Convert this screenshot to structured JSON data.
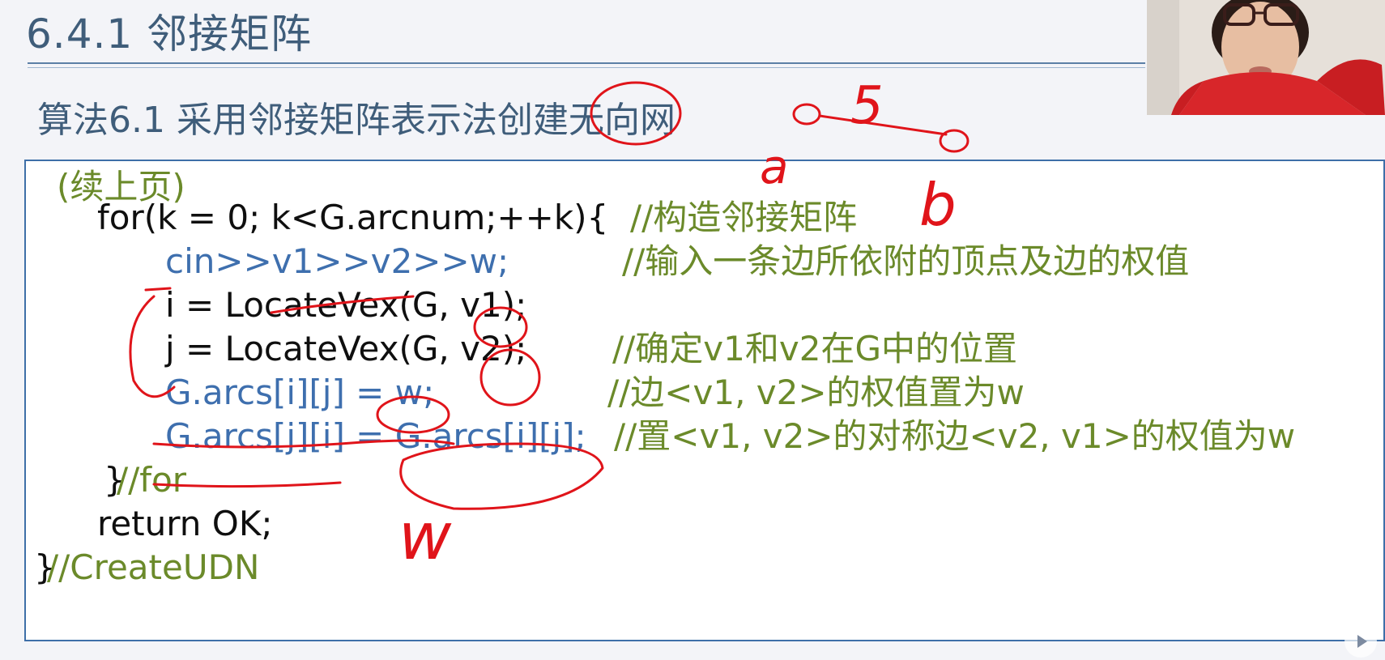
{
  "slide": {
    "section_title": "6.4.1 邻接矩阵",
    "algorithm_title": "算法6.1 采用邻接矩阵表示法创建无向网"
  },
  "code": {
    "continued": "(续上页)",
    "for_head": "for(k = 0; k<G.arcnum;++k){",
    "for_comment": "//构造邻接矩阵",
    "cin_stmt": "cin>>v1>>v2>>w;",
    "cin_comment": "//输入一条边所依附的顶点及边的权值",
    "locate_i": "i = LocateVex(G, v1);",
    "locate_j": "j = LocateVex(G, v2);",
    "locate_comment": "//确定v1和v2在G中的位置",
    "arcs_ij": "G.arcs[i][j] = w;",
    "arcs_ij_comment": "//边<v1, v2>的权值置为w",
    "arcs_ji": "G.arcs[j][i] = G.arcs[i][j];",
    "arcs_ji_comment": "//置<v1, v2>的对称边<v2, v1>的权值为w",
    "close_for_brace": "}",
    "close_for_comment": "//for",
    "return_stmt": "return OK;",
    "close_func_brace": "}",
    "close_func_comment": "//CreateUDN"
  },
  "annotations": {
    "edge_weight": "5",
    "vertex_a": "a",
    "vertex_b": "b",
    "handwritten_w": "w"
  },
  "colors": {
    "title": "#3f5d7a",
    "code_black": "#0f0f0f",
    "code_blue": "#3e6fae",
    "comment_green": "#6b8a2a",
    "ink_red": "#e0141a",
    "border": "#3e6fa8"
  },
  "icons": {
    "webcam": "presenter-webcam",
    "play": "play-icon"
  }
}
